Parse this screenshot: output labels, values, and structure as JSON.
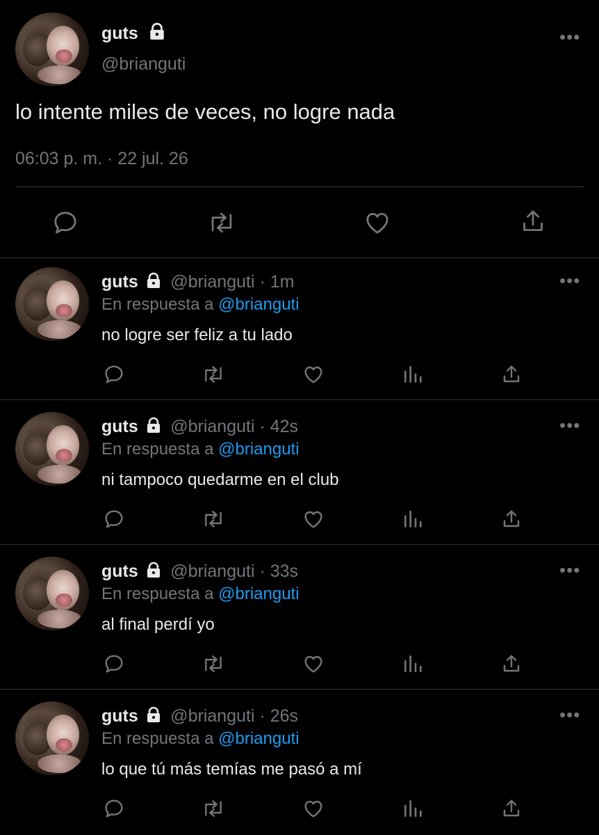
{
  "main_tweet": {
    "name": "guts",
    "handle": "@brianguti",
    "text": "lo intente miles de veces, no logre nada",
    "timestamp": "06:03 p. m. · 22 jul. 26",
    "icons": [
      "reply-icon",
      "retweet-icon",
      "like-icon",
      "share-icon"
    ]
  },
  "replies": [
    {
      "name": "guts",
      "handle_time": "@brianguti · 1m",
      "reply_prefix": "En respuesta a",
      "reply_to": "@brianguti",
      "text": "no logre ser feliz a tu lado"
    },
    {
      "name": "guts",
      "handle_time": "@brianguti · 42s",
      "reply_prefix": "En respuesta a",
      "reply_to": "@brianguti",
      "text": "ni tampoco quedarme en el club"
    },
    {
      "name": "guts",
      "handle_time": "@brianguti · 33s",
      "reply_prefix": "En respuesta a",
      "reply_to": "@brianguti",
      "text": "al final perdí yo"
    },
    {
      "name": "guts",
      "handle_time": "@brianguti · 26s",
      "reply_prefix": "En respuesta a",
      "reply_to": "@brianguti",
      "text": "lo que tú más temías me pasó a mí"
    }
  ],
  "more_label": "•••",
  "colors": {
    "background": "#000000",
    "text": "#e7e9ea",
    "muted": "#71767b",
    "link": "#1d9bf0",
    "divider": "#2f3336"
  }
}
